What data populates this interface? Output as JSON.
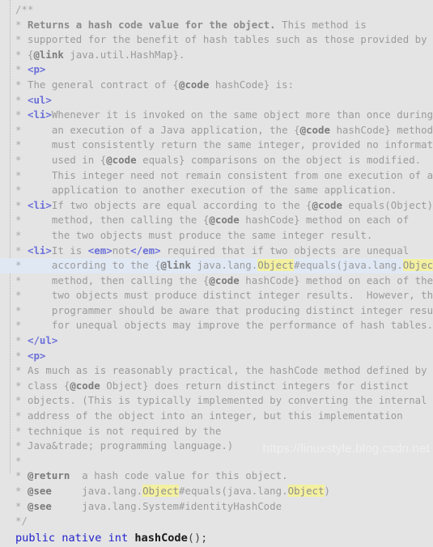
{
  "editor": {
    "language": "java",
    "background_color": "#e4e4e4",
    "highlight_line_color": "#e0e8f4",
    "search_highlight_color": "#f3f0a0",
    "keyword_color": "#2222cc",
    "tag_color": "#6b70d8",
    "comment_color": "#9b9b9b"
  },
  "watermark": {
    "text": "https://linuxstyle.blog.csdn.net"
  },
  "lines": {
    "l1": {
      "delim": "/**"
    },
    "l2": {
      "star": "*",
      "bold": " Returns a hash code value for the object.",
      "rest": " This method is"
    },
    "l3": {
      "star": "*",
      "text": " supported for the benefit of hash tables such as those provided by"
    },
    "l4": {
      "star": "*",
      "pre": " {",
      "doctag": "@link",
      "post": " java.util.HashMap}."
    },
    "l5": {
      "star": "*",
      "sp": " ",
      "tag": "<p>"
    },
    "l6": {
      "star": "*",
      "pre": " The general contract of {",
      "doctag": "@code",
      "post": " hashCode} is:"
    },
    "l7": {
      "star": "*",
      "sp": " ",
      "tag": "<ul>"
    },
    "l8": {
      "star": "*",
      "sp": " ",
      "tag": "<li>",
      "post": "Whenever it is invoked on the same object more than once during"
    },
    "l9": {
      "star": "*",
      "pre": "     an execution of a Java application, the {",
      "doctag": "@code",
      "post": " hashCode} method"
    },
    "l10": {
      "star": "*",
      "text": "     must consistently return the same integer, provided no information"
    },
    "l11": {
      "star": "*",
      "pre": "     used in {",
      "doctag": "@code",
      "post": " equals} comparisons on the object is modified."
    },
    "l12": {
      "star": "*",
      "text": "     This integer need not remain consistent from one execution of an"
    },
    "l13": {
      "star": "*",
      "text": "     application to another execution of the same application."
    },
    "l14": {
      "star": "*",
      "sp": " ",
      "tag": "<li>",
      "mid": "If two objects are equal according to the {",
      "doctag": "@code",
      "post": " equals(Object)}"
    },
    "l15": {
      "star": "*",
      "pre": "     method, then calling the {",
      "doctag": "@code",
      "post": " hashCode} method on each of"
    },
    "l16": {
      "star": "*",
      "text": "     the two objects must produce the same integer result."
    },
    "l17": {
      "star": "*",
      "sp": " ",
      "tag": "<li>",
      "t1": "It is ",
      "tag2": "<em>",
      "t2": "not",
      "tag3": "</em>",
      "t3": " required that if two objects are unequal"
    },
    "l18": {
      "star": "*",
      "pre": "     according to the {",
      "doctag": "@link",
      "mid": " java.lang.",
      "hl1": "Object",
      "mid2": "#equals(java.lang.",
      "hl2": "Object",
      "post": ")}"
    },
    "l19": {
      "star": "*",
      "pre": "     method, then calling the {",
      "doctag": "@code",
      "post": " hashCode} method on each of the"
    },
    "l20": {
      "star": "*",
      "text": "     two objects must produce distinct integer results.  However, the"
    },
    "l21": {
      "star": "*",
      "text": "     programmer should be aware that producing distinct integer results"
    },
    "l22": {
      "star": "*",
      "text": "     for unequal objects may improve the performance of hash tables."
    },
    "l23": {
      "star": "*",
      "sp": " ",
      "tag": "</ul>"
    },
    "l24": {
      "star": "*",
      "sp": " ",
      "tag": "<p>"
    },
    "l25": {
      "star": "*",
      "text": " As much as is reasonably practical, the hashCode method defined by"
    },
    "l26": {
      "star": "*",
      "pre": " class {",
      "doctag": "@code",
      "post": " Object} does return distinct integers for distinct"
    },
    "l27": {
      "star": "*",
      "text": " objects. (This is typically implemented by converting the internal"
    },
    "l28": {
      "star": "*",
      "text": " address of the object into an integer, but this implementation"
    },
    "l29": {
      "star": "*",
      "text": " technique is not required by the"
    },
    "l30": {
      "star": "*",
      "text": " Java&trade; programming language.)"
    },
    "l31": {
      "star": "*",
      "text": ""
    },
    "l32": {
      "star": "*",
      "sp": " ",
      "doctag": "@return",
      "post": "  a hash code value for this object."
    },
    "l33": {
      "star": "*",
      "sp": " ",
      "doctag": "@see",
      "mid": "     java.lang.",
      "hl1": "Object",
      "mid2": "#equals(java.lang.",
      "hl2": "Object",
      "post": ")"
    },
    "l34": {
      "star": "*",
      "sp": " ",
      "doctag": "@see",
      "post": "     java.lang.System#identityHashCode"
    },
    "l35": {
      "delim": "*/"
    },
    "l36": {
      "kw1": "public native int",
      "sp": " ",
      "method": "hashCode",
      "punct": "();"
    }
  }
}
